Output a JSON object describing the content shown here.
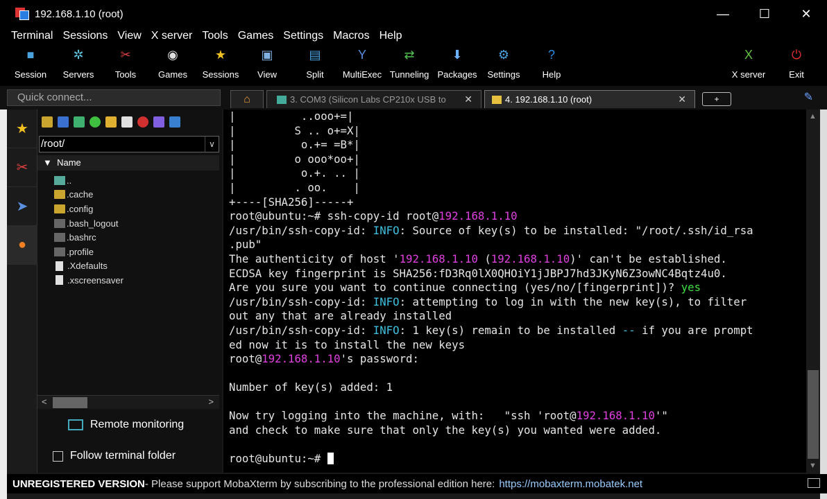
{
  "window": {
    "title": "192.168.1.10 (root)",
    "min": "—",
    "max": "☐",
    "close": "✕"
  },
  "menu": [
    "Terminal",
    "Sessions",
    "View",
    "X server",
    "Tools",
    "Games",
    "Settings",
    "Macros",
    "Help"
  ],
  "toolbar": [
    {
      "label": "Session",
      "icon": "session-icon",
      "glyph": "■",
      "color": "#4aa3df"
    },
    {
      "label": "Servers",
      "icon": "servers-icon",
      "glyph": "✲",
      "color": "#5bc0de"
    },
    {
      "label": "Tools",
      "icon": "tools-icon",
      "glyph": "✂",
      "color": "#e04040"
    },
    {
      "label": "Games",
      "icon": "games-icon",
      "glyph": "◉",
      "color": "#dddddd"
    },
    {
      "label": "Sessions",
      "icon": "sessions-star-icon",
      "glyph": "★",
      "color": "#f0c020"
    },
    {
      "label": "View",
      "icon": "view-icon",
      "glyph": "▣",
      "color": "#7fb0e0"
    },
    {
      "label": "Split",
      "icon": "split-icon",
      "glyph": "▤",
      "color": "#4aa3df"
    },
    {
      "label": "MultiExec",
      "icon": "multiexec-icon",
      "glyph": "Y",
      "color": "#5a8fe0"
    },
    {
      "label": "Tunneling",
      "icon": "tunneling-icon",
      "glyph": "⇄",
      "color": "#50c050"
    },
    {
      "label": "Packages",
      "icon": "packages-icon",
      "glyph": "⬇",
      "color": "#6ab0ff"
    },
    {
      "label": "Settings",
      "icon": "settings-icon",
      "glyph": "⚙",
      "color": "#4aa3df"
    },
    {
      "label": "Help",
      "icon": "help-icon",
      "glyph": "?",
      "color": "#2a8de0"
    },
    {
      "label": "X server",
      "icon": "xserver-icon",
      "glyph": "X",
      "color": "#60c040"
    },
    {
      "label": "Exit",
      "icon": "exit-icon",
      "glyph": "⏻",
      "color": "#e03030"
    }
  ],
  "quick_connect": "Quick connect...",
  "tabs": {
    "home_glyph": "⌂",
    "com_label": "3. COM3  (Silicon Labs CP210x USB to",
    "ssh_label": "4. 192.168.1.10 (root)",
    "close_glyph": "✕",
    "add_glyph": "+"
  },
  "sidebar": {
    "path": "/root/",
    "column": "Name",
    "files": [
      {
        "name": "..",
        "type": "up"
      },
      {
        "name": ".cache",
        "type": "folder"
      },
      {
        "name": ".config",
        "type": "folder"
      },
      {
        "name": ".bash_logout",
        "type": "file"
      },
      {
        "name": ".bashrc",
        "type": "file"
      },
      {
        "name": ".profile",
        "type": "file"
      },
      {
        "name": ".Xdefaults",
        "type": "doc"
      },
      {
        "name": ".xscreensaver",
        "type": "doc"
      }
    ],
    "remote_monitoring": "Remote monitoring",
    "follow_folder": "Follow terminal folder"
  },
  "terminal": {
    "lines": [
      [
        {
          "t": "|          ..ooo+=|"
        }
      ],
      [
        {
          "t": "|         S .. o+=X|"
        }
      ],
      [
        {
          "t": "|          o.+= =B*|"
        }
      ],
      [
        {
          "t": "|         o ooo*oo+|"
        }
      ],
      [
        {
          "t": "|          o.+. .. |"
        }
      ],
      [
        {
          "t": "|         . oo.    |"
        }
      ],
      [
        {
          "t": "+----[SHA256]-----+"
        }
      ],
      [
        {
          "t": "root@ubuntu:~# ssh-copy-id root@"
        },
        {
          "t": "192.168.1.10",
          "c": "mag"
        }
      ],
      [
        {
          "t": "/usr/bin/ssh-copy-id: "
        },
        {
          "t": "INFO",
          "c": "cy"
        },
        {
          "t": ": Source of key(s) to be installed: \"/root/.ssh/id_rsa"
        }
      ],
      [
        {
          "t": ".pub\""
        }
      ],
      [
        {
          "t": "The authenticity of host '"
        },
        {
          "t": "192.168.1.10",
          "c": "mag"
        },
        {
          "t": " ("
        },
        {
          "t": "192.168.1.10",
          "c": "mag"
        },
        {
          "t": ")' can't be established."
        }
      ],
      [
        {
          "t": "ECDSA key fingerprint is SHA256:fD3Rq0lX0QHOiY1jJBPJ7hd3JKyN6Z3owNC4Bqtz4u0."
        }
      ],
      [
        {
          "t": "Are you sure you want to continue connecting (yes/no/[fingerprint])? "
        },
        {
          "t": "yes",
          "c": "gr"
        }
      ],
      [
        {
          "t": "/usr/bin/ssh-copy-id: "
        },
        {
          "t": "INFO",
          "c": "cy"
        },
        {
          "t": ": attempting to log in with the new key(s), to filter"
        }
      ],
      [
        {
          "t": "out any that are already installed"
        }
      ],
      [
        {
          "t": "/usr/bin/ssh-copy-id: "
        },
        {
          "t": "INFO",
          "c": "cy"
        },
        {
          "t": ": 1 key(s) remain to be installed "
        },
        {
          "t": "--",
          "c": "cy"
        },
        {
          "t": " if you are prompt"
        }
      ],
      [
        {
          "t": "ed now it is to install the new keys"
        }
      ],
      [
        {
          "t": "root@"
        },
        {
          "t": "192.168.1.10",
          "c": "mag"
        },
        {
          "t": "'s password:"
        }
      ],
      [
        {
          "t": ""
        }
      ],
      [
        {
          "t": "Number of key(s) added: 1"
        }
      ],
      [
        {
          "t": ""
        }
      ],
      [
        {
          "t": "Now try logging into the machine, with:   \"ssh 'root@"
        },
        {
          "t": "192.168.1.10",
          "c": "mag"
        },
        {
          "t": "'\""
        }
      ],
      [
        {
          "t": "and check to make sure that only the key(s) you wanted were added."
        }
      ],
      [
        {
          "t": ""
        }
      ],
      [
        {
          "t": "root@ubuntu:~# "
        }
      ]
    ]
  },
  "status": {
    "bold": "UNREGISTERED VERSION",
    "text": "  -  Please support MobaXterm by subscribing to the professional edition here:",
    "url": "https://mobaxterm.mobatek.net"
  }
}
